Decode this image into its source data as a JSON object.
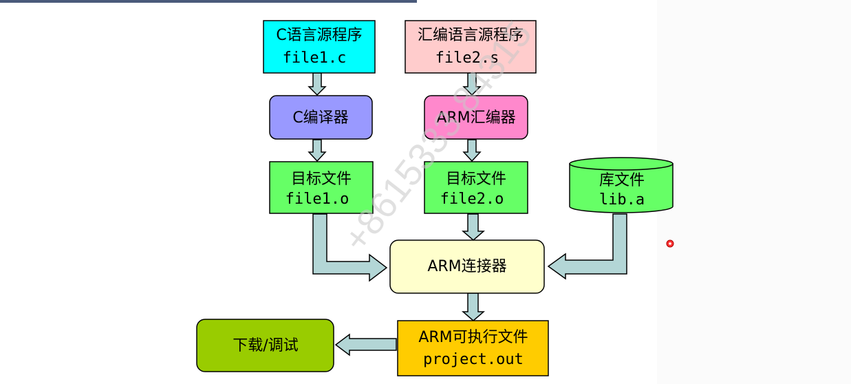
{
  "nodes": {
    "c_source": {
      "line1": "C语言源程序",
      "line2": "file1.c",
      "fill": "#00ffff"
    },
    "asm_source": {
      "line1": "汇编语言源程序",
      "line2": "file2.s",
      "fill": "#ffcccc"
    },
    "c_compiler": {
      "label": "C编译器",
      "fill": "#9999ff"
    },
    "arm_assembler": {
      "label": "ARM汇编器",
      "fill": "#ff88cc"
    },
    "obj1": {
      "line1": "目标文件",
      "line2": "file1.o",
      "fill": "#66ff66"
    },
    "obj2": {
      "line1": "目标文件",
      "line2": "file2.o",
      "fill": "#66ff66"
    },
    "lib": {
      "line1": "库文件",
      "line2": "lib.a",
      "fill": "#66ff66"
    },
    "linker": {
      "label": "ARM连接器",
      "fill": "#ffffcc"
    },
    "executable": {
      "line1": "ARM可执行文件",
      "line2": "project.out",
      "fill": "#ffcc00"
    },
    "download": {
      "label": "下载/调试",
      "fill": "#99cc00"
    }
  },
  "watermark": "+8615333 84315",
  "arrow_color": "#b3d6d6"
}
